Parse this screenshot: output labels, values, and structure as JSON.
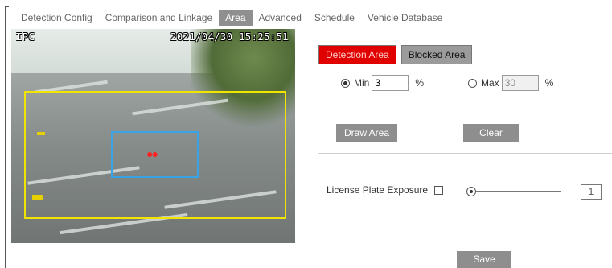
{
  "tabs": [
    {
      "label": "Detection Config"
    },
    {
      "label": "Comparison and Linkage"
    },
    {
      "label": "Area"
    },
    {
      "label": "Advanced"
    },
    {
      "label": "Schedule"
    },
    {
      "label": "Vehicle Database"
    }
  ],
  "active_tab": "Area",
  "video": {
    "channel_label": "IPC",
    "timestamp": "2021/04/30 15:25:51"
  },
  "area_tabs": {
    "detection": "Detection Area",
    "blocked": "Blocked Area"
  },
  "min": {
    "label": "Min",
    "value": "3",
    "unit": "%",
    "selected": true
  },
  "max": {
    "label": "Max",
    "value": "30",
    "unit": "%",
    "selected": false
  },
  "buttons": {
    "draw_area": "Draw Area",
    "clear": "Clear",
    "save": "Save"
  },
  "exposure": {
    "label": "License Plate Exposure",
    "checked": false,
    "slider_value": "1",
    "slider_fraction": 0
  },
  "colors": {
    "active_tab_bg": "#8f8f8f",
    "detection_tab_bg": "#e00000",
    "button_bg": "#8e8e8e",
    "detection_box": "#f0e400",
    "plate_box": "#3aa3e3"
  }
}
